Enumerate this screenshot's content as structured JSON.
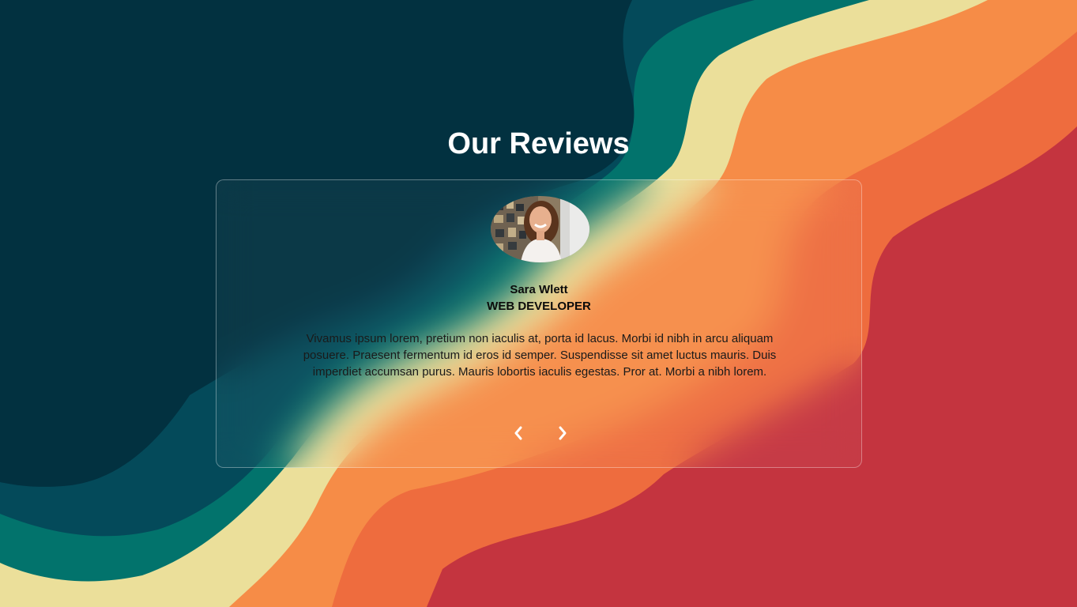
{
  "section": {
    "heading": "Our Reviews"
  },
  "review": {
    "name": "Sara Wlett",
    "role": "WEB DEVELOPER",
    "text": "Vivamus ipsum lorem, pretium non iaculis at, porta id lacus. Morbi id nibh in arcu aliquam posuere. Praesent fermentum id eros id semper. Suspendisse sit amet luctus mauris. Duis imperdiet accumsan purus. Mauris lobortis iaculis egestas. Pror at. Morbi a nibh lorem."
  },
  "navigation": {
    "prev_icon": "chevron-left-icon",
    "next_icon": "chevron-right-icon"
  },
  "colors": {
    "navy": "#023140",
    "dark_teal": "#044a5a",
    "teal": "#02736c",
    "cream": "#ebdf9a",
    "orange": "#f68c47",
    "dark_orange": "#ee6c3e",
    "red": "#c4343f",
    "heading": "#ffffff"
  }
}
